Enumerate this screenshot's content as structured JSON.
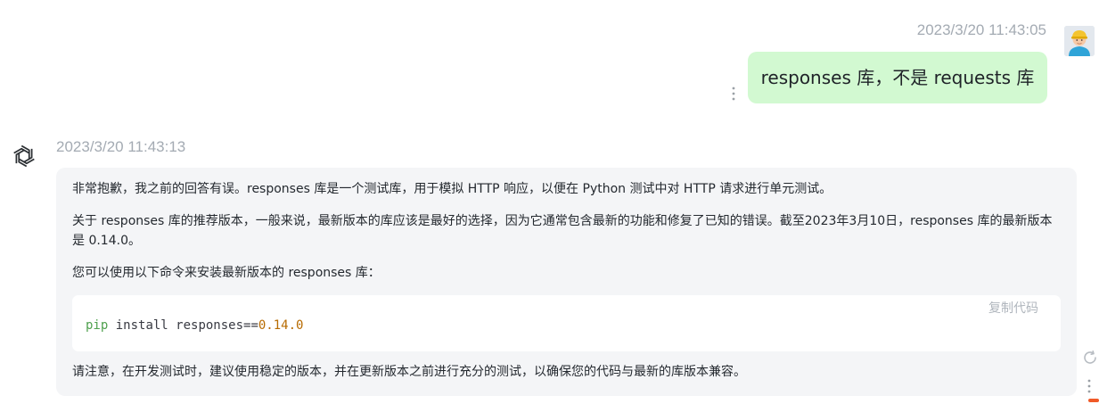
{
  "user_message": {
    "timestamp": "2023/3/20 11:43:05",
    "text": "responses 库，不是 requests 库",
    "avatar_icon": "user-avatar-icon",
    "menu_icon": "more-vertical-icon",
    "bubble_color": "#d2f9d1"
  },
  "bot_message": {
    "timestamp": "2023/3/20 11:43:13",
    "logo_icon": "openai-logo-icon",
    "paragraphs": [
      "非常抱歉，我之前的回答有误。responses 库是一个测试库，用于模拟 HTTP 响应，以便在 Python 测试中对 HTTP 请求进行单元测试。",
      "关于 responses 库的推荐版本，一般来说，最新版本的库应该是最好的选择，因为它通常包含最新的功能和修复了已知的错误。截至2023年3月10日，responses 库的最新版本是 0.14.0。",
      "您可以使用以下命令来安装最新版本的 responses 库："
    ],
    "code": {
      "copy_label": "复制代码",
      "cmd": "pip",
      "rest": " install responses==",
      "version": "0.14.0"
    },
    "closing": "请注意，在开发测试时，建议使用稳定的版本，并在更新版本之前进行充分的测试，以确保您的代码与最新的库版本兼容。",
    "bubble_color": "#f4f5f7"
  },
  "side_actions": {
    "refresh_icon": "refresh-icon",
    "menu_icon": "more-vertical-icon"
  }
}
